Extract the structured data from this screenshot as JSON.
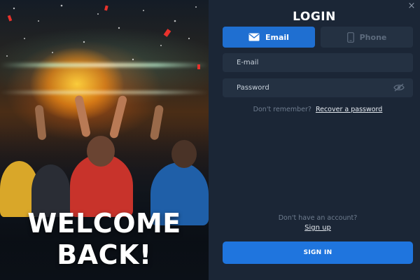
{
  "hero": {
    "line1": "WELCOME",
    "line2": "BACK!"
  },
  "dialog": {
    "close_icon": "×",
    "title": "LOGIN",
    "tabs": [
      {
        "label": "Email",
        "icon": "envelope-icon",
        "active": true
      },
      {
        "label": "Phone",
        "icon": "smartphone-icon",
        "active": false
      }
    ],
    "email_placeholder": "E-mail",
    "password_placeholder": "Password",
    "forgot_prompt": "Don't remember?",
    "recover_link": "Recover a password",
    "no_account_prompt": "Don't have an account?",
    "signup_link": "Sign up",
    "signin_label": "SIGN IN"
  },
  "colors": {
    "panel_bg": "#1b2636",
    "field_bg": "#243142",
    "accent": "#1f6fd1",
    "button": "#1f75de"
  }
}
